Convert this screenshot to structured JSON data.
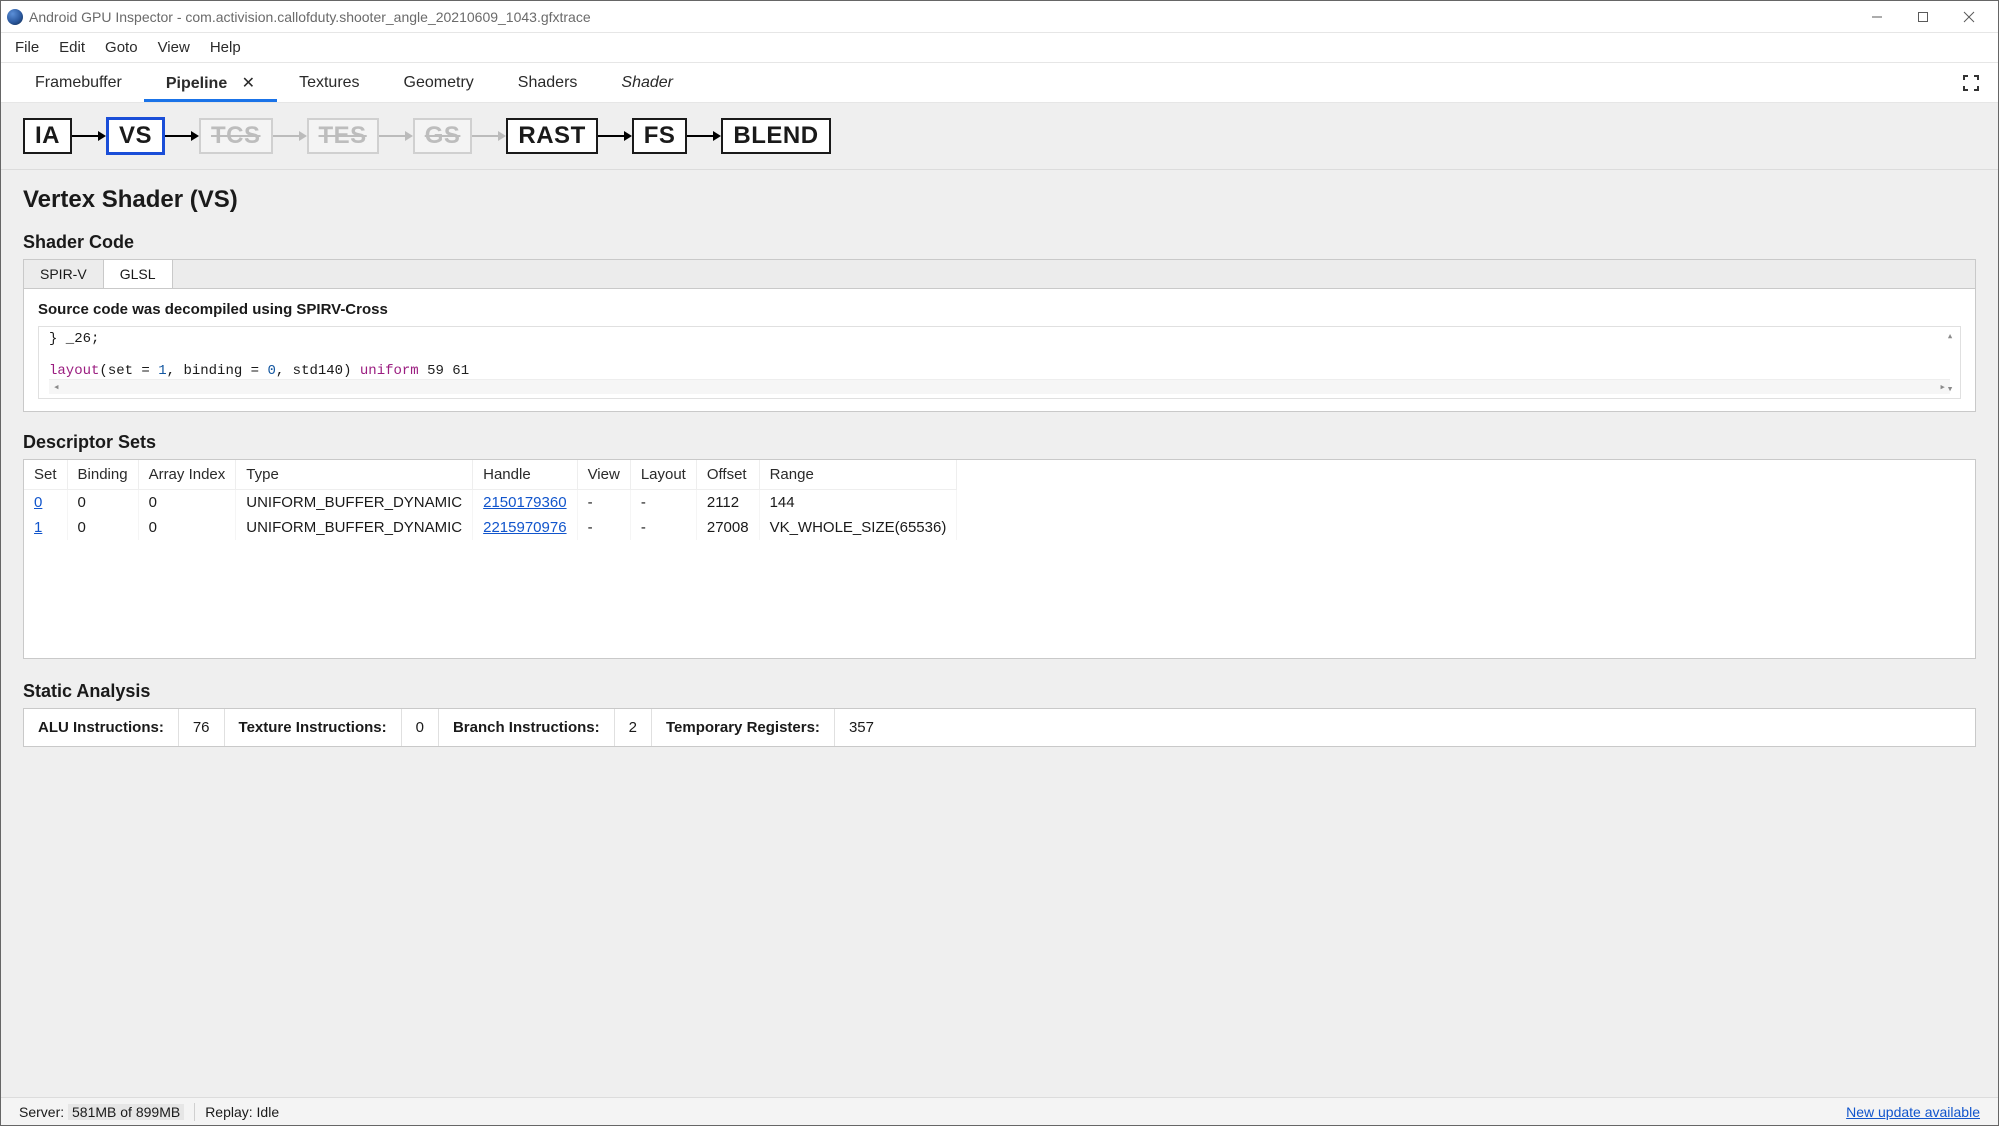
{
  "window": {
    "title": "Android GPU Inspector - com.activision.callofduty.shooter_angle_20210609_1043.gfxtrace"
  },
  "menu": {
    "items": [
      "File",
      "Edit",
      "Goto",
      "View",
      "Help"
    ]
  },
  "tabs": {
    "items": [
      {
        "label": "Framebuffer",
        "active": false
      },
      {
        "label": "Pipeline",
        "active": true,
        "closeable": true
      },
      {
        "label": "Textures",
        "active": false
      },
      {
        "label": "Geometry",
        "active": false
      },
      {
        "label": "Shaders",
        "active": false
      },
      {
        "label": "Shader",
        "active": false,
        "italic": true
      }
    ]
  },
  "pipeline": {
    "stages": [
      {
        "label": "IA",
        "state": "normal"
      },
      {
        "label": "VS",
        "state": "selected"
      },
      {
        "label": "TCS",
        "state": "disabled"
      },
      {
        "label": "TES",
        "state": "disabled"
      },
      {
        "label": "GS",
        "state": "disabled"
      },
      {
        "label": "RAST",
        "state": "normal"
      },
      {
        "label": "FS",
        "state": "normal"
      },
      {
        "label": "BLEND",
        "state": "normal"
      }
    ]
  },
  "page": {
    "title": "Vertex Shader (VS)"
  },
  "shader_code": {
    "title": "Shader Code",
    "tabs": [
      "SPIR-V",
      "GLSL"
    ],
    "active_tab": "GLSL",
    "note": "Source code was decompiled using SPIRV-Cross",
    "lines": {
      "l1": "} _26;",
      "l2_kw1": "layout",
      "l2_paren_open": "(set = ",
      "l2_n1": "1",
      "l2_mid": ", binding = ",
      "l2_n2": "0",
      "l2_std": ", std140) ",
      "l2_kw2": "uniform",
      "l2_tail": "  59 61"
    }
  },
  "descriptor_sets": {
    "title": "Descriptor Sets",
    "columns": [
      "Set",
      "Binding",
      "Array Index",
      "Type",
      "Handle",
      "View",
      "Layout",
      "Offset",
      "Range"
    ],
    "rows": [
      {
        "set": "0",
        "binding": "0",
        "array_index": "0",
        "type": "UNIFORM_BUFFER_DYNAMIC",
        "handle": "2150179360",
        "view": "-",
        "layout": "-",
        "offset": "2112",
        "range": "144"
      },
      {
        "set": "1",
        "binding": "0",
        "array_index": "0",
        "type": "UNIFORM_BUFFER_DYNAMIC",
        "handle": "2215970976",
        "view": "-",
        "layout": "-",
        "offset": "27008",
        "range": "VK_WHOLE_SIZE(65536)"
      }
    ]
  },
  "static_analysis": {
    "title": "Static Analysis",
    "labels": {
      "alu": "ALU Instructions:",
      "tex": "Texture Instructions:",
      "branch": "Branch Instructions:",
      "temp": "Temporary Registers:"
    },
    "values": {
      "alu": "76",
      "tex": "0",
      "branch": "2",
      "temp": "357"
    }
  },
  "status": {
    "server_label": "Server:",
    "server_mem": "581MB of 899MB",
    "replay_label": "Replay:",
    "replay_value": "Idle",
    "update_link": "New update available"
  }
}
